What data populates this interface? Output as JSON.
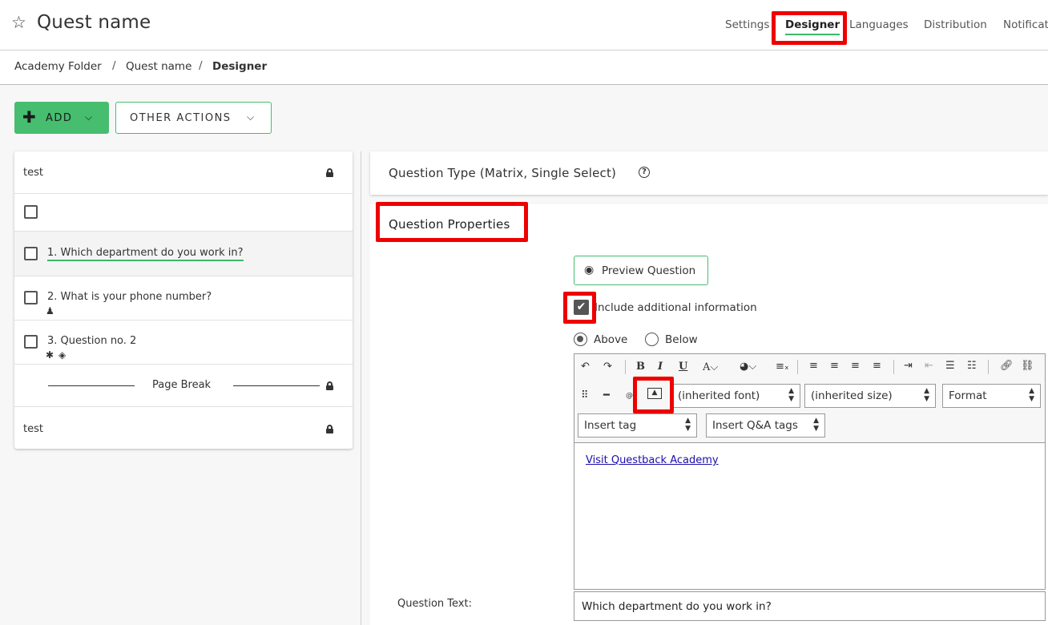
{
  "header": {
    "title": "Quest name",
    "tabs": [
      "Settings",
      "Designer",
      "Languages",
      "Distribution",
      "Notificat"
    ]
  },
  "breadcrumb": [
    "Academy Folder",
    "Quest name",
    "Designer"
  ],
  "actions": {
    "add_label": "ADD",
    "other_actions_label": "OTHER ACTIONS"
  },
  "list": {
    "items": [
      {
        "text": "test"
      },
      {
        "text": "1.  Which department do you work in?"
      },
      {
        "text": "2.  What is your phone number?"
      },
      {
        "text": "3.  Question no. 2"
      },
      {
        "text": "Page Break"
      },
      {
        "text": "test"
      }
    ]
  },
  "question": {
    "type_label": "Question Type (Matrix, Single Select)",
    "properties_title": "Question Properties",
    "preview_label": "Preview Question",
    "include_info_label": "Include additional information",
    "include_info_checked": true,
    "position_options": [
      "Above",
      "Below"
    ],
    "position_selected": "Above",
    "editor": {
      "font": "(inherited font)",
      "size": "(inherited size)",
      "format": "Format",
      "insert_tag": "Insert tag",
      "insert_qa_tags": "Insert Q&A tags",
      "link_text": "Visit Questback Academy"
    },
    "question_text_label": "Question Text:",
    "question_text_value": "Which department do you work in?"
  },
  "colors": {
    "accent": "#46bd6f",
    "highlight": "#ee0000"
  }
}
